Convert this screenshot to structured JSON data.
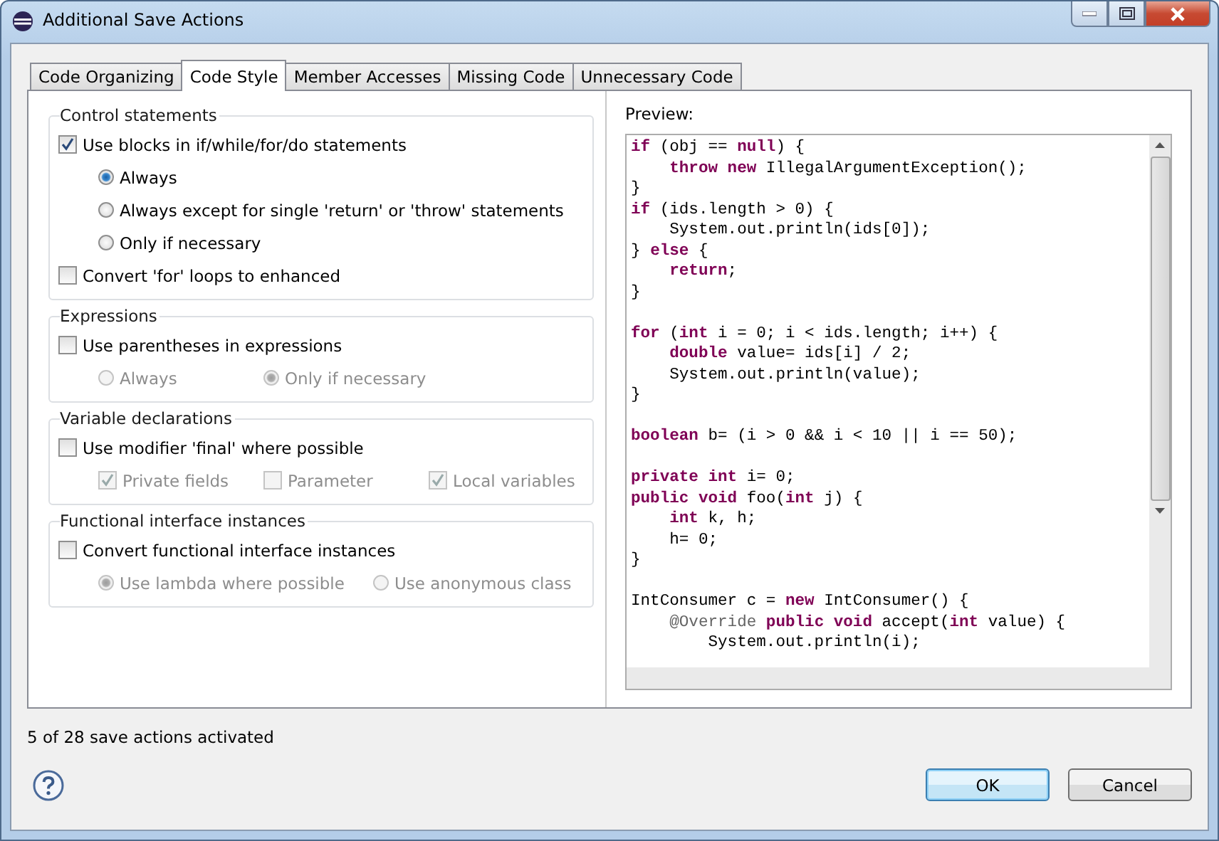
{
  "window": {
    "title": "Additional Save Actions"
  },
  "tabs": [
    {
      "label": "Code Organizing",
      "selected": false
    },
    {
      "label": "Code Style",
      "selected": true
    },
    {
      "label": "Member Accesses",
      "selected": false
    },
    {
      "label": "Missing Code",
      "selected": false
    },
    {
      "label": "Unnecessary Code",
      "selected": false
    }
  ],
  "groups": [
    {
      "title": "Control statements",
      "items": [
        {
          "kind": "checkbox",
          "label": "Use blocks in if/while/for/do statements",
          "checked": true,
          "disabled": false,
          "option_rows": [
            [
              {
                "kind": "radio",
                "label": "Always",
                "checked": true,
                "disabled": false
              }
            ],
            [
              {
                "kind": "radio",
                "label": "Always except for single 'return' or 'throw' statements",
                "checked": false,
                "disabled": false
              }
            ],
            [
              {
                "kind": "radio",
                "label": "Only if necessary",
                "checked": false,
                "disabled": false
              }
            ]
          ]
        },
        {
          "kind": "checkbox",
          "label": "Convert 'for' loops to enhanced",
          "checked": false,
          "disabled": false
        }
      ]
    },
    {
      "title": "Expressions",
      "items": [
        {
          "kind": "checkbox",
          "label": "Use parentheses in expressions",
          "checked": false,
          "disabled": false,
          "option_rows": [
            [
              {
                "kind": "radio",
                "label": "Always",
                "checked": false,
                "disabled": true
              },
              {
                "kind": "radio",
                "label": "Only if necessary",
                "checked": true,
                "disabled": true
              }
            ]
          ]
        }
      ]
    },
    {
      "title": "Variable declarations",
      "items": [
        {
          "kind": "checkbox",
          "label": "Use modifier 'final' where possible",
          "checked": false,
          "disabled": false,
          "option_rows": [
            [
              {
                "kind": "checkbox",
                "label": "Private fields",
                "checked": true,
                "disabled": true
              },
              {
                "kind": "checkbox",
                "label": "Parameter",
                "checked": false,
                "disabled": true
              },
              {
                "kind": "checkbox",
                "label": "Local variables",
                "checked": true,
                "disabled": true
              }
            ]
          ]
        }
      ]
    },
    {
      "title": "Functional interface instances",
      "items": [
        {
          "kind": "checkbox",
          "label": "Convert functional interface instances",
          "checked": false,
          "disabled": false,
          "option_rows": [
            [
              {
                "kind": "radio",
                "label": "Use lambda where possible",
                "checked": true,
                "disabled": true
              },
              {
                "kind": "radio",
                "label": "Use anonymous class",
                "checked": false,
                "disabled": true
              }
            ]
          ]
        }
      ]
    }
  ],
  "preview": {
    "label": "Preview:",
    "code_blocks": [
      [
        [
          {
            "kind": "keyword",
            "text": "if"
          },
          {
            "kind": "plain",
            "text": " (obj == "
          },
          {
            "kind": "keyword",
            "text": "null"
          },
          {
            "kind": "plain",
            "text": ") {"
          }
        ],
        [
          {
            "kind": "keyword",
            "text": "    throw new"
          },
          {
            "kind": "plain",
            "text": " IllegalArgumentException();"
          }
        ],
        [
          {
            "kind": "plain",
            "text": "}"
          }
        ],
        [
          {
            "kind": "keyword",
            "text": "if"
          },
          {
            "kind": "plain",
            "text": " (ids.length > 0) {"
          }
        ],
        [
          {
            "kind": "plain",
            "text": "    System.out.println(ids[0]);"
          }
        ],
        [
          {
            "kind": "plain",
            "text": "} "
          },
          {
            "kind": "keyword",
            "text": "else"
          },
          {
            "kind": "plain",
            "text": " {"
          }
        ],
        [
          {
            "kind": "keyword",
            "text": "    return"
          },
          {
            "kind": "plain",
            "text": ";"
          }
        ],
        [
          {
            "kind": "plain",
            "text": "}"
          }
        ]
      ],
      [
        [
          {
            "kind": "keyword",
            "text": "for"
          },
          {
            "kind": "plain",
            "text": " ("
          },
          {
            "kind": "keyword",
            "text": "int"
          },
          {
            "kind": "plain",
            "text": " i = 0; i < ids.length; i++) {"
          }
        ],
        [
          {
            "kind": "keyword",
            "text": "    double"
          },
          {
            "kind": "plain",
            "text": " value= ids[i] / 2;"
          }
        ],
        [
          {
            "kind": "plain",
            "text": "    System.out.println(value);"
          }
        ],
        [
          {
            "kind": "plain",
            "text": "}"
          }
        ]
      ],
      [
        [
          {
            "kind": "keyword",
            "text": "boolean"
          },
          {
            "kind": "plain",
            "text": " b= (i > 0 && i < 10 || i == 50);"
          }
        ]
      ],
      [
        [
          {
            "kind": "keyword",
            "text": "private int"
          },
          {
            "kind": "plain",
            "text": " i= 0;"
          }
        ],
        [
          {
            "kind": "keyword",
            "text": "public void"
          },
          {
            "kind": "plain",
            "text": " foo("
          },
          {
            "kind": "keyword",
            "text": "int"
          },
          {
            "kind": "plain",
            "text": " j) {"
          }
        ],
        [
          {
            "kind": "keyword",
            "text": "    int"
          },
          {
            "kind": "plain",
            "text": " k, h;"
          }
        ],
        [
          {
            "kind": "plain",
            "text": "    h= 0;"
          }
        ],
        [
          {
            "kind": "plain",
            "text": "}"
          }
        ]
      ],
      [
        [
          {
            "kind": "plain",
            "text": "IntConsumer c = "
          },
          {
            "kind": "keyword",
            "text": "new"
          },
          {
            "kind": "plain",
            "text": " IntConsumer() {"
          }
        ],
        [
          {
            "kind": "annotation",
            "text": "    @Override"
          },
          {
            "kind": "keyword",
            "text": " public void"
          },
          {
            "kind": "plain",
            "text": " accept("
          },
          {
            "kind": "keyword",
            "text": "int"
          },
          {
            "kind": "plain",
            "text": " value) {"
          }
        ],
        [
          {
            "kind": "plain",
            "text": "        System.out.println(i);"
          }
        ]
      ]
    ]
  },
  "status": "5 of 28 save actions activated",
  "buttons": [
    {
      "label": "OK",
      "default": true
    },
    {
      "label": "Cancel",
      "default": false
    }
  ]
}
